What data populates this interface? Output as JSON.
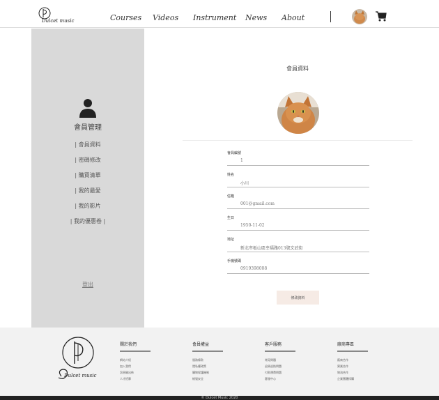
{
  "header": {
    "logo_text": "Dulcet music",
    "nav": [
      "Courses",
      "Videos",
      "Instrument",
      "News",
      "About"
    ],
    "colors": {
      "accent": "#d9a080"
    }
  },
  "sidebar": {
    "title": "會員管理",
    "items": [
      "會員資料",
      "密碼修改",
      "購買清單",
      "我的最愛",
      "我的影片",
      "我的優惠卷"
    ],
    "logout": "登出"
  },
  "main": {
    "title": "會員資料",
    "fields": [
      {
        "label": "會員編號",
        "value": "1"
      },
      {
        "label": "姓名",
        "value": "小川"
      },
      {
        "label": "信箱",
        "value": "001@gmail.com"
      },
      {
        "label": "生日",
        "value": "1950-11-02"
      },
      {
        "label": "地址",
        "value": "新北市板山區幸福路013號文武街"
      },
      {
        "label": "手機號碼",
        "value": "0919398008"
      }
    ],
    "edit_button": "修改資料"
  },
  "footer": {
    "logo_text": "Dulcet music",
    "columns": [
      {
        "heading": "關於我們",
        "links": [
          "網站介紹",
          "加入我們",
          "訊息輸出佈",
          "人才招募"
        ]
      },
      {
        "heading": "會員權益",
        "links": [
          "服務條款",
          "隱私權政策",
          "購物保護機制",
          "帳號安全"
        ]
      },
      {
        "heading": "客戶服務",
        "links": [
          "常見問題",
          "退貨退換問題",
          "付款運費問題",
          "客服中心"
        ]
      },
      {
        "heading": "廠商專區",
        "links": [
          "廠商合作",
          "異業合作",
          "物流合作",
          "企業團體採購"
        ]
      }
    ],
    "copyright": "© Dulcet Music 2020"
  }
}
